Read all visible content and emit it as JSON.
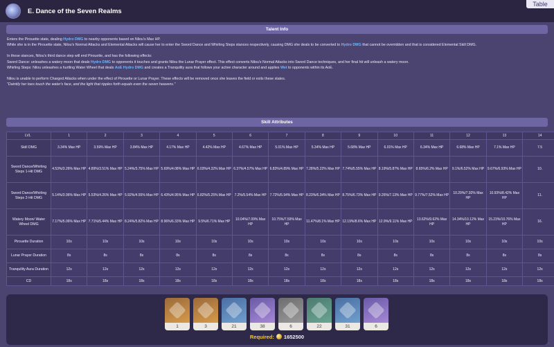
{
  "header": {
    "title": "E. Dance of the Seven Realms",
    "table_button": "Table",
    "icon": "skill-icon"
  },
  "talent_info": {
    "heading": "Talent Info",
    "p1_a": "Enters the Pirouette state, dealing ",
    "p1_hl": "Hydro DMG",
    "p1_b": " to nearby opponents based on Nilou's Max HP.",
    "p2_a": "While she is in the Pirouette state, Nilou's Normal Attacks and Elemental Attacks will cause her to enter the Sword Dance and Whirling Steps stances respectively, causing DMG she deals to be converted to ",
    "p2_hl": "Hydro DMG",
    "p2_b": " that cannot be overridden and that is considered Elemental Skill DMG.",
    "p3": "In these stances, Nilou's third dance step will end Pirouette, and has the following effects:",
    "p4_a": "Sword Dance: unleashes a watery moon that deals ",
    "p4_hl": "Hydro DMG",
    "p4_b": " to opponents it touches and grants Nilou the Lunar Prayer effect. This effect converts Nilou's Normal Attacks into Sword Dance techniques, and her final hit will unleash a watery moon.",
    "p5_a": "Whirling Steps: Nilou unleashes a hurtling Water Wheel that deals ",
    "p5_hl": "AoE Hydro DMG",
    "p5_b": " and creates a Tranquility aura that follows your active character around and applies ",
    "p5_hl2": "Wet",
    "p5_c": " to opponents within its AoE.",
    "p6": "Nilou is unable to perform Charged Attacks when under the effect of Pirouette or Lunar Prayer. These effects will be removed once she leaves the field or exits these states.",
    "quote": "\"Daintily her toes touch the water's face, and the light that ripples forth equals even the seven heavens.\""
  },
  "skill_attributes": {
    "heading": "Skill Attributes",
    "lvl_label": "LVL",
    "levels": [
      "1",
      "2",
      "3",
      "4",
      "5",
      "6",
      "7",
      "8",
      "9",
      "10",
      "11",
      "12",
      "13",
      "14"
    ],
    "rows": [
      {
        "label": "Skill DMG",
        "values": [
          "3.34% Max HP",
          "3.59% Max HP",
          "3.84% Max HP",
          "4.17% Max HP",
          "4.42% Max HP",
          "4.67% Max HP",
          "5.01% Max HP",
          "5.34% Max HP",
          "5.68% Max HP",
          "6.01% Max HP",
          "6.34% Max HP",
          "6.68% Max HP",
          "7.1% Max HP",
          "7.5"
        ]
      },
      {
        "label": "Sword Dance/Whirling Steps 1-Hit DMG",
        "values": [
          "4.53%/3.26% Max HP",
          "4.89%/3.51% Max HP",
          "5.24%/3.75% Max HP",
          "5.69%/4.08% Max HP",
          "6.03%/4.32% Max HP",
          "6.37%/4.57% Max HP",
          "6.83%/4.89% Max HP",
          "7.28%/5.22% Max HP",
          "7.74%/5.55% Max HP",
          "8.19%/5.87% Max HP",
          "8.65%/6.2% Max HP",
          "9.1%/6.52% Max HP",
          "9.67%/6.93% Max HP",
          "10."
        ]
      },
      {
        "label": "Sword Dance/Whirling Steps 2-Hit DMG",
        "values": [
          "5.14%/3.96% Max HP",
          "5.53%/4.26% Max HP",
          "5.92%/4.55% Max HP",
          "6.43%/4.95% Max HP",
          "6.82%/5.25% Max HP",
          "7.2%/5.54% Max HP",
          "7.72%/5.94% Max HP",
          "8.23%/6.34% Max HP",
          "8.75%/6.73% Max HP",
          "9.26%/7.13% Max HP",
          "9.77%/7.52% Max HP",
          "10.29%/7.92% Max HP",
          "10.93%/8.42% Max HP",
          "11."
        ]
      },
      {
        "label": "Watery Moon/ Water Wheel DMG",
        "values": [
          "7.17%/5.06% Max HP",
          "7.71%/5.44% Max HP",
          "8.24%/5.82% Max HP",
          "8.96%/6.33% Max HP",
          "9.5%/6.71% Max HP",
          "10.04%/7.09% Max HP",
          "10.75%/7.59% Max HP",
          "11.47%/8.1% Max HP",
          "12.19%/8.6% Max HP",
          "12.9%/9.11% Max HP",
          "13.62%/9.62% Max HP",
          "14.34%/10.12% Max HP",
          "15.23%/10.76% Max HP",
          "16."
        ]
      },
      {
        "label": "Pirouette Duration",
        "values": [
          "10s",
          "10s",
          "10s",
          "10s",
          "10s",
          "10s",
          "10s",
          "10s",
          "10s",
          "10s",
          "10s",
          "10s",
          "10s",
          "10s"
        ]
      },
      {
        "label": "Lunar Prayer Duration",
        "values": [
          "8s",
          "8s",
          "8s",
          "8s",
          "8s",
          "8s",
          "8s",
          "8s",
          "8s",
          "8s",
          "8s",
          "8s",
          "8s",
          "8s"
        ]
      },
      {
        "label": "Tranquility Aura Duration",
        "values": [
          "12s",
          "12s",
          "12s",
          "12s",
          "12s",
          "12s",
          "12s",
          "12s",
          "12s",
          "12s",
          "12s",
          "12s",
          "12s",
          "12s"
        ]
      },
      {
        "label": "CD",
        "values": [
          "18s",
          "18s",
          "18s",
          "18s",
          "18s",
          "18s",
          "18s",
          "18s",
          "18s",
          "18s",
          "18s",
          "18s",
          "18s",
          "18s"
        ]
      }
    ]
  },
  "materials": [
    {
      "icon": "crown-icon",
      "count": "1",
      "rarity": "5"
    },
    {
      "icon": "weekly-boss-material-icon",
      "count": "3",
      "rarity": "5"
    },
    {
      "icon": "talent-book-gold-icon",
      "count": "21",
      "rarity": "3"
    },
    {
      "icon": "talent-book-purple-icon",
      "count": "38",
      "rarity": "4"
    },
    {
      "icon": "fungal-spore-gray-icon",
      "count": "6",
      "rarity": "1"
    },
    {
      "icon": "fungal-spore-green-icon",
      "count": "22",
      "rarity": "2"
    },
    {
      "icon": "fungal-spore-blue-icon",
      "count": "31",
      "rarity": "3"
    },
    {
      "icon": "fungal-spore-purple-icon",
      "count": "6",
      "rarity": "4"
    }
  ],
  "required": {
    "label": "Required:",
    "amount": "1652500",
    "icon": "mora-icon"
  },
  "corner": "..."
}
